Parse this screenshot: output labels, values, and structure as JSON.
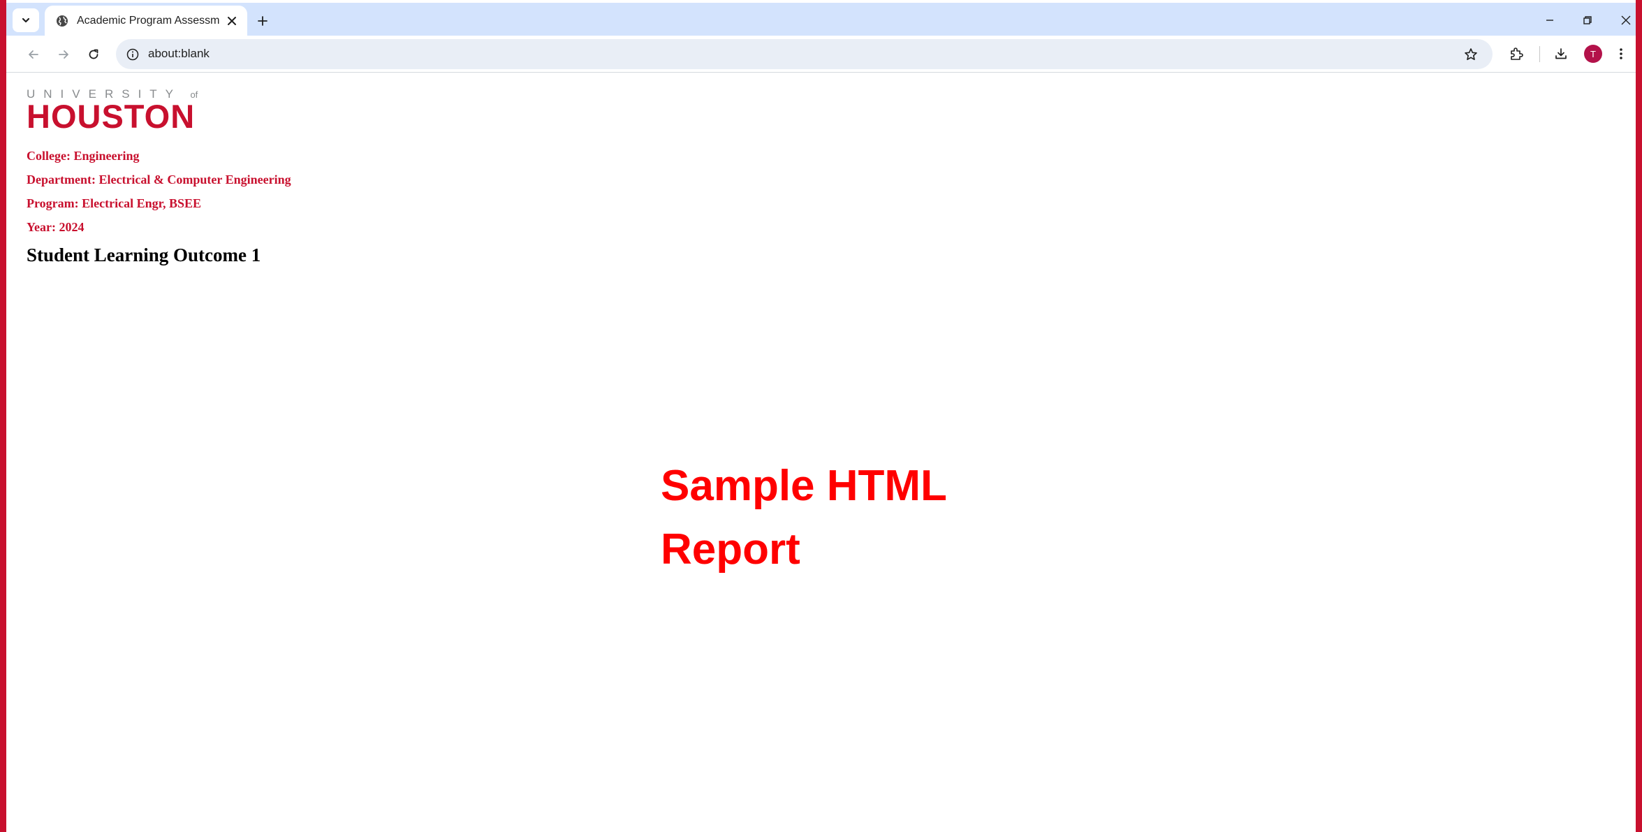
{
  "browser": {
    "tab": {
      "title": "Academic Program Assessment",
      "icon": "globe-icon"
    },
    "address_bar": {
      "url": "about:blank",
      "icon": "info-icon"
    },
    "profile_initial": "T"
  },
  "report": {
    "logo": {
      "top_text": "UNIVERSITY",
      "of_text": "of",
      "main_text": "HOUSTON"
    },
    "college": "College: Engineering",
    "department": "Department: Electrical & Computer Engineering",
    "program": "Program: Electrical Engr, BSEE",
    "year": "Year: 2024",
    "section_heading": "Student Learning Outcome 1"
  },
  "overlay": {
    "line1": "Sample HTML",
    "line2": "Report"
  },
  "colors": {
    "brand_red": "#c8102e",
    "overlay_red": "#ff0000",
    "tabstrip_bg": "#d3e3fd",
    "omnibox_bg": "#e9eef6"
  }
}
